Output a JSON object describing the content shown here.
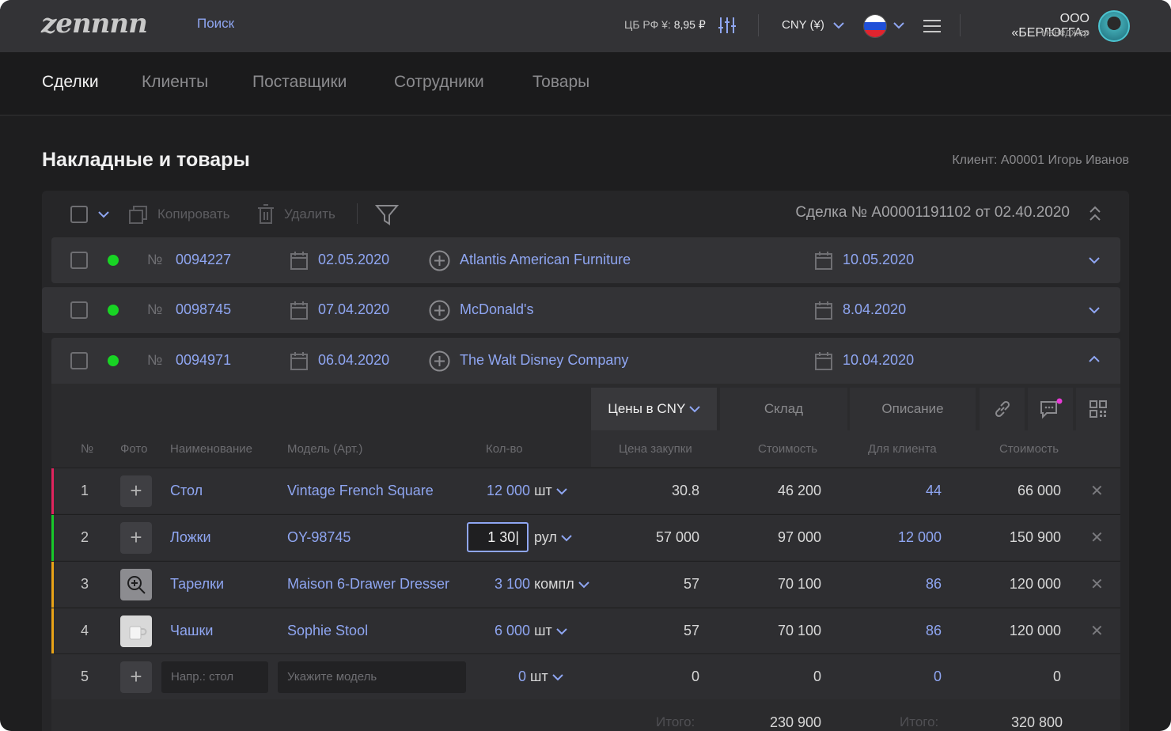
{
  "topbar": {
    "logo": "zennnn",
    "search": "Поиск",
    "rate_label": "ЦБ РФ ¥:",
    "rate_value": "8,95 ₽",
    "currency": "CNY (¥)",
    "company": "ООО «БЕРЛОГГА»",
    "role": "менеджер"
  },
  "nav": [
    "Сделки",
    "Клиенты",
    "Поставщики",
    "Сотрудники",
    "Товары"
  ],
  "page": {
    "title": "Накладные и товары",
    "client": "Клиент:  A00001 Игорь Иванов"
  },
  "toolbar": {
    "copy": "Копировать",
    "delete": "Удалить",
    "deal": "Сделка № A00001191102 от 02.40.2020"
  },
  "invoices": [
    {
      "no_label": "№",
      "number": "0094227",
      "date": "02.05.2020",
      "company": "Atlantis American Furniture",
      "date2": "10.05.2020",
      "status_color": "#18d424"
    },
    {
      "no_label": "№",
      "number": "0098745",
      "date": "07.04.2020",
      "company": "McDonald's",
      "date2": "8.04.2020",
      "status_color": "#18d424"
    },
    {
      "no_label": "№",
      "number": "0094971",
      "date": "06.04.2020",
      "company": "The Walt Disney Company",
      "date2": "10.04.2020",
      "status_color": "#18d424"
    }
  ],
  "tabs": {
    "prices": "Цены в CNY",
    "stock": "Склад",
    "description": "Описание"
  },
  "table": {
    "headers": [
      "№",
      "Фото",
      "Наименование",
      "Модель (Арт.)",
      "Кол-во",
      "Цена закупки",
      "Стоимость",
      "Для клиента",
      "Стоимость"
    ],
    "rows": [
      {
        "n": "1",
        "name": "Стол",
        "model": "Vintage French Square",
        "qty": "12 000",
        "unit": "шт",
        "buy": "30.8",
        "cost": "46 200",
        "client": "44",
        "total": "66 000",
        "bar": "#e0245e"
      },
      {
        "n": "2",
        "name": "Ложки",
        "model": "OY-98745",
        "qty": "1 30|",
        "unit": "рул",
        "buy": "57 000",
        "cost": "97 000",
        "client": "12 000",
        "total": "150 900",
        "bar": "#18c92a"
      },
      {
        "n": "3",
        "name": "Тарелки",
        "model": "Maison 6-Drawer Dresser",
        "qty": "3 100",
        "unit": "компл",
        "buy": "57",
        "cost": "70 100",
        "client": "86",
        "total": "120 000",
        "bar": "#e8a317"
      },
      {
        "n": "4",
        "name": "Чашки",
        "model": "Sophie Stool",
        "qty": "6 000",
        "unit": "шт",
        "buy": "57",
        "cost": "70 100",
        "client": "86",
        "total": "120 000",
        "bar": "#e8a317"
      },
      {
        "n": "5",
        "name_placeholder": "Напр.: стол",
        "model_placeholder": "Укажите модель",
        "qty": "0",
        "unit": "шт",
        "buy": "0",
        "cost": "0",
        "client": "0",
        "total": "0"
      }
    ],
    "totals": {
      "label": "Итого:",
      "cost": "230 900",
      "total": "320 800"
    }
  }
}
